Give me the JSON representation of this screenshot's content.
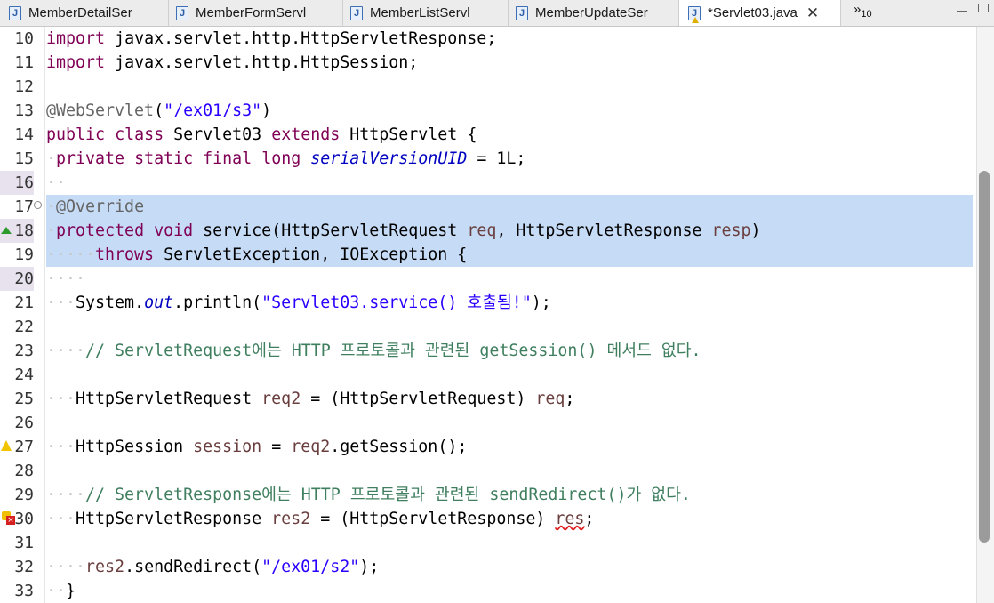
{
  "tabs": [
    {
      "label": "MemberDetailSer"
    },
    {
      "label": "MemberFormServl"
    },
    {
      "label": "MemberListServl"
    },
    {
      "label": "MemberUpdateSer"
    },
    {
      "label": "*Servlet03.java"
    }
  ],
  "tab_overflow": {
    "chevron": "»",
    "count": "10"
  },
  "tab_icon_glyph": "J",
  "close_glyph": "✕",
  "lines": [
    {
      "n": "10",
      "tokens": [
        [
          "kw",
          "import"
        ],
        [
          "",
          "javax.servlet.http.HttpServletResponse;"
        ]
      ]
    },
    {
      "n": "11",
      "tokens": [
        [
          "kw",
          "import"
        ],
        [
          "",
          "javax.servlet.http.HttpSession;"
        ]
      ]
    },
    {
      "n": "12",
      "tokens": []
    },
    {
      "n": "13",
      "tokens": [
        [
          "ann",
          "@WebServlet"
        ],
        [
          "",
          "("
        ],
        [
          "str",
          "\"/ex01/s3\""
        ],
        [
          "",
          ")"
        ]
      ]
    },
    {
      "n": "14",
      "tokens": [
        [
          "kw",
          "public"
        ],
        [
          "kw",
          "class"
        ],
        [
          "",
          "Servlet03"
        ],
        [
          "kw",
          "extends"
        ],
        [
          "",
          "HttpServlet {"
        ]
      ]
    },
    {
      "n": "15",
      "tokens": [
        [
          "dot",
          "·"
        ],
        [
          "kw",
          "private"
        ],
        [
          "kw",
          "static"
        ],
        [
          "kw",
          "final"
        ],
        [
          "kw",
          "long"
        ],
        [
          "fld",
          "serialVersionUID"
        ],
        [
          "",
          "= 1L;"
        ]
      ]
    },
    {
      "n": "16",
      "tokens": [
        [
          "dot",
          "··"
        ]
      ]
    },
    {
      "n": "17",
      "tokens": [
        [
          "dot",
          "·"
        ],
        [
          "ann",
          "@Override"
        ]
      ]
    },
    {
      "n": "18",
      "tokens": [
        [
          "dot",
          "·"
        ],
        [
          "kw",
          "protected"
        ],
        [
          "kw",
          "void"
        ],
        [
          "",
          "service(HttpServletRequest"
        ],
        [
          "var",
          "req"
        ],
        [
          "",
          ", HttpServletResponse"
        ],
        [
          "var",
          "resp"
        ],
        [
          "",
          ")"
        ]
      ]
    },
    {
      "n": "19",
      "tokens": [
        [
          "dot",
          "·····"
        ],
        [
          "kw",
          "throws"
        ],
        [
          "",
          "ServletException, IOException {"
        ]
      ]
    },
    {
      "n": "20",
      "tokens": [
        [
          "dot",
          "····"
        ]
      ]
    },
    {
      "n": "21",
      "tokens": [
        [
          "dot",
          "···"
        ],
        [
          "",
          "System."
        ],
        [
          "fld",
          "out"
        ],
        [
          "",
          ".println("
        ],
        [
          "str",
          "\"Servlet03.service() 호출됨!\""
        ],
        [
          "",
          ");"
        ]
      ]
    },
    {
      "n": "22",
      "tokens": []
    },
    {
      "n": "23",
      "tokens": [
        [
          "dot",
          "····"
        ],
        [
          "com",
          "// ServletRequest에는 HTTP 프로토콜과 관련된 getSession() 메서드 없다."
        ]
      ]
    },
    {
      "n": "24",
      "tokens": []
    },
    {
      "n": "25",
      "tokens": [
        [
          "dot",
          "···"
        ],
        [
          "",
          "HttpServletRequest"
        ],
        [
          "var",
          "req2"
        ],
        [
          "",
          "= (HttpServletRequest)"
        ],
        [
          "var",
          "req"
        ],
        [
          "",
          ";"
        ]
      ]
    },
    {
      "n": "26",
      "tokens": []
    },
    {
      "n": "27",
      "tokens": [
        [
          "dot",
          "···"
        ],
        [
          "",
          "HttpSession"
        ],
        [
          "var",
          "session"
        ],
        [
          "",
          "="
        ],
        [
          "var",
          "req2"
        ],
        [
          "",
          ".getSession();"
        ]
      ]
    },
    {
      "n": "28",
      "tokens": []
    },
    {
      "n": "29",
      "tokens": [
        [
          "dot",
          "····"
        ],
        [
          "com",
          "// ServletResponse에는 HTTP 프로토콜과 관련된 sendRedirect()가 없다."
        ]
      ]
    },
    {
      "n": "30",
      "tokens": [
        [
          "dot",
          "···"
        ],
        [
          "",
          "HttpServletResponse"
        ],
        [
          "var",
          "res2"
        ],
        [
          "",
          "= (HttpServletResponse)"
        ],
        [
          "err",
          "res"
        ],
        [
          "",
          ";"
        ]
      ]
    },
    {
      "n": "31",
      "tokens": []
    },
    {
      "n": "32",
      "tokens": [
        [
          "dot",
          "····"
        ],
        [
          "var",
          "res2"
        ],
        [
          "",
          ".sendRedirect("
        ],
        [
          "str",
          "\"/ex01/s2\""
        ],
        [
          "",
          ");"
        ]
      ]
    },
    {
      "n": "33",
      "tokens": [
        [
          "dot",
          "··"
        ],
        [
          "",
          "}"
        ]
      ]
    }
  ],
  "colors": {
    "keyword": "#7f0055",
    "string": "#2a00ff",
    "comment": "#3f7f5f",
    "annotation": "#646464",
    "field": "#0000c0",
    "variable": "#6a3e3e",
    "selection": "#c6dbf5"
  }
}
